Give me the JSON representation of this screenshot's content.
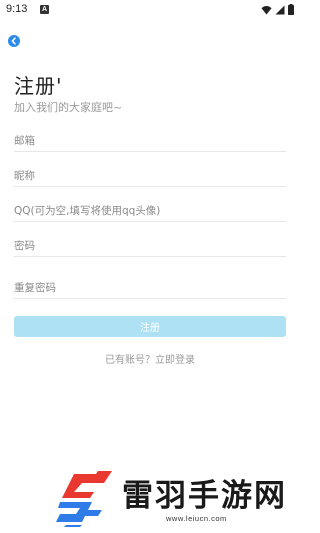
{
  "status_bar": {
    "time": "9:13",
    "app_icon_letter": "A"
  },
  "header": {
    "title": "注册'",
    "subtitle": "加入我们的大家庭吧~"
  },
  "form": {
    "email_placeholder": "邮箱",
    "nickname_placeholder": "昵称",
    "qq_placeholder": "QQ(可为空,填写将使用qq头像)",
    "password_placeholder": "密码",
    "confirm_password_placeholder": "重复密码",
    "register_label": "注册",
    "login_link": "已有账号？立即登录"
  },
  "watermark": {
    "brand": "雷羽手游网",
    "url": "www.leiucn.com"
  },
  "colors": {
    "accent": "#2b8ce8",
    "button_bg": "#aee1f3",
    "logo_red": "#e8382f",
    "logo_blue": "#2f7be8"
  }
}
